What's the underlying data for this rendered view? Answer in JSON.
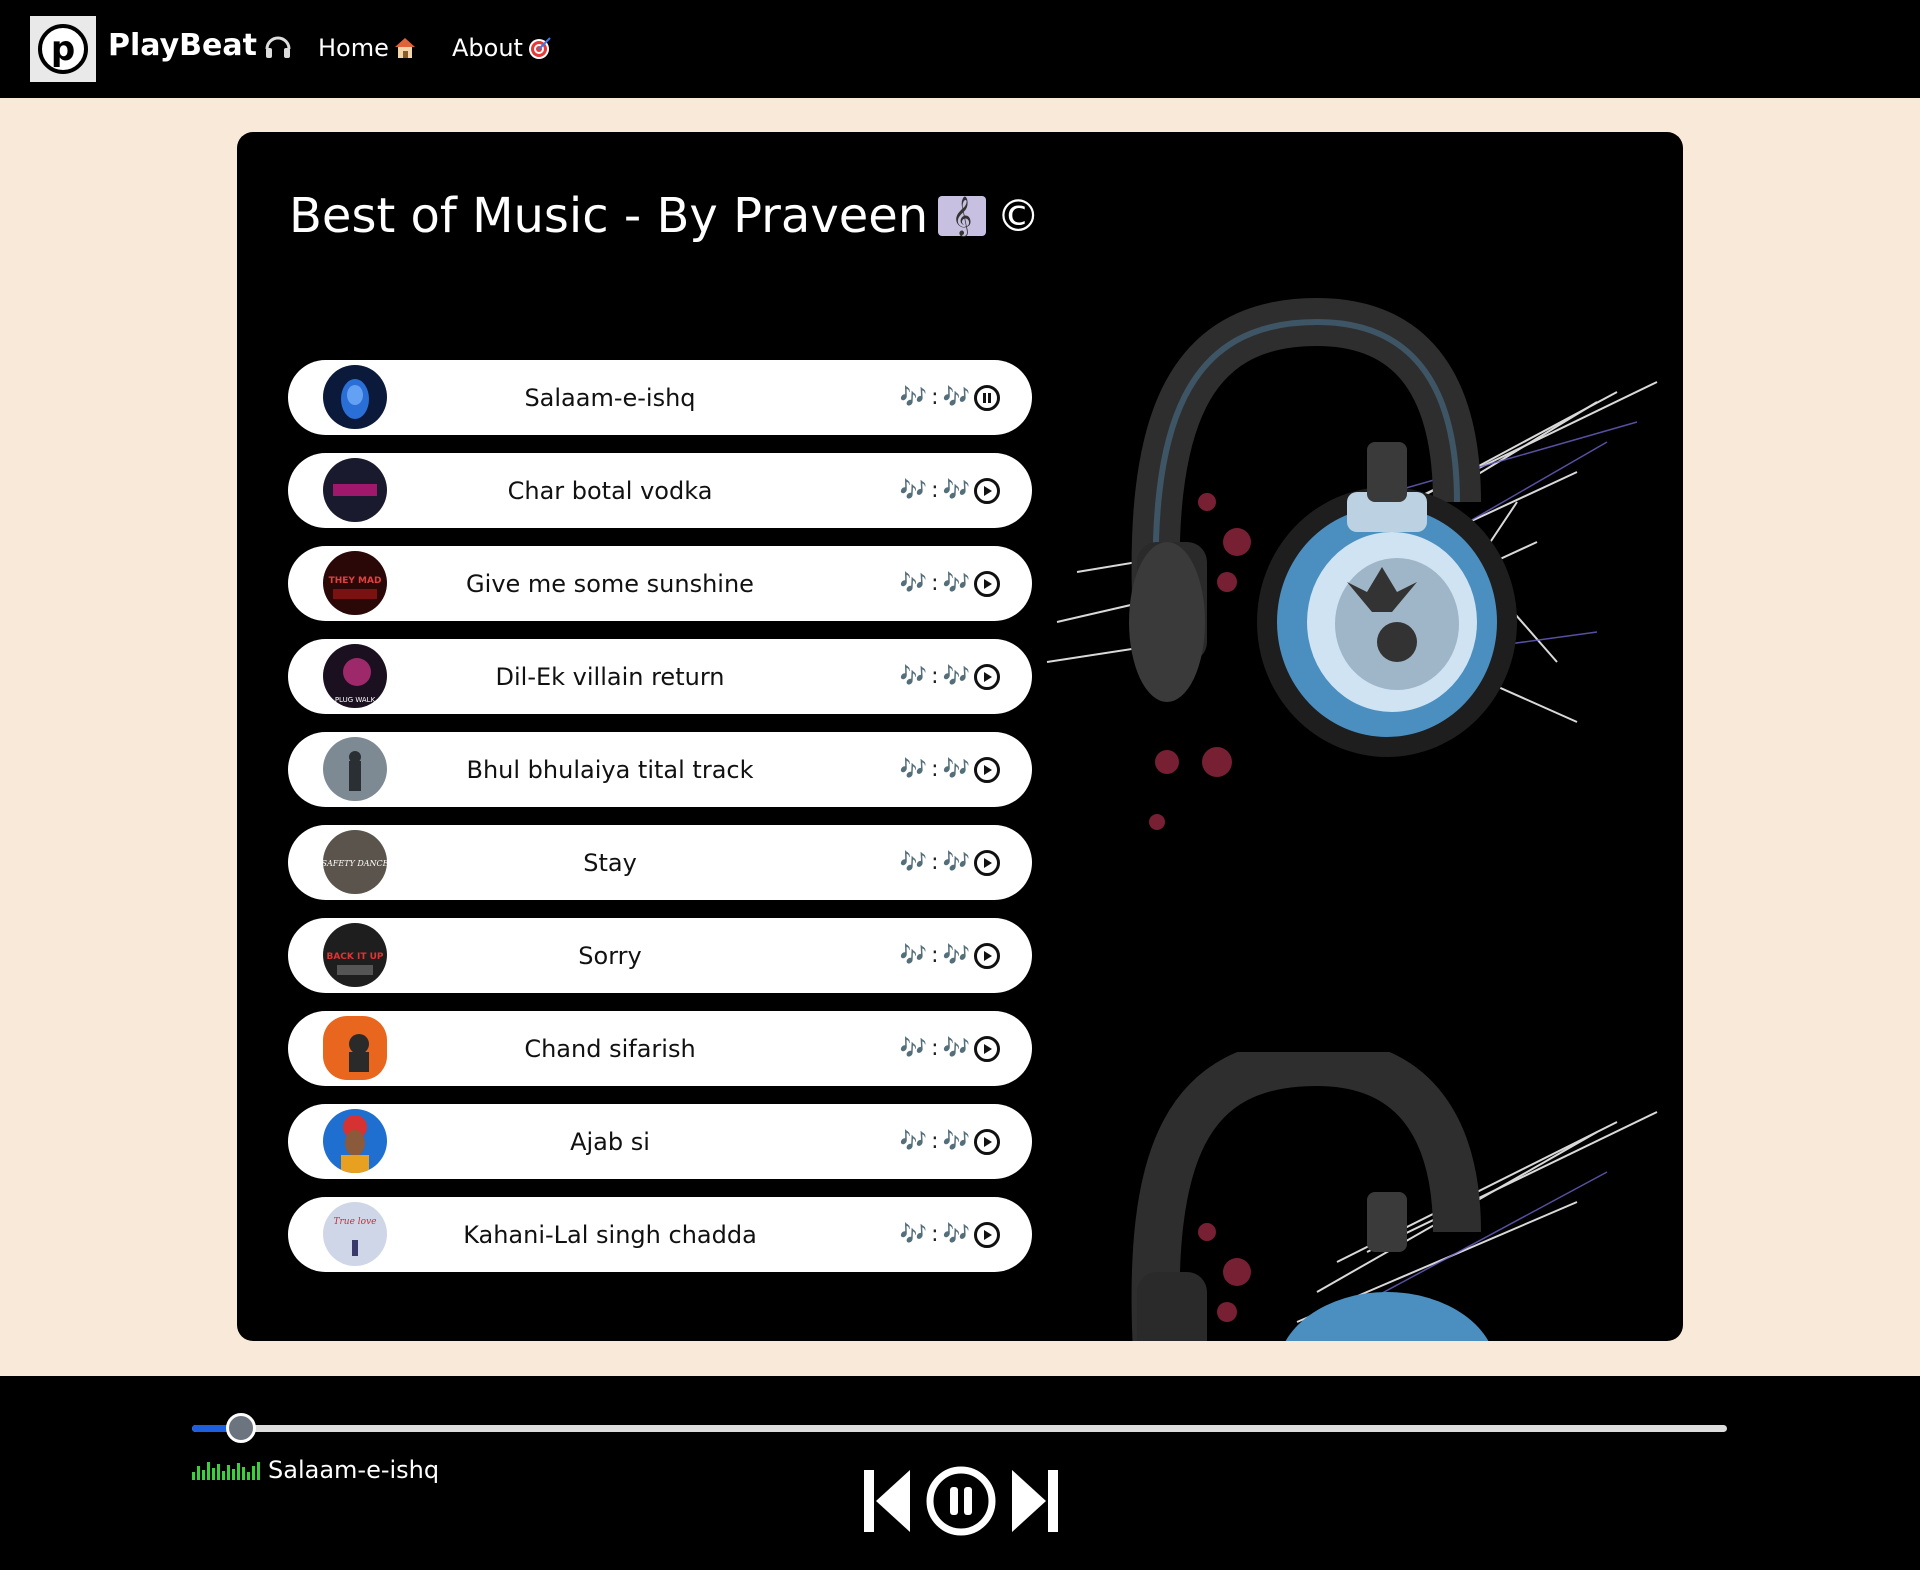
{
  "navbar": {
    "brand": "PlayBeat",
    "brand_icon": "headphones-icon",
    "links": [
      {
        "label": "Home",
        "icon": "house-icon"
      },
      {
        "label": "About",
        "icon": "target-icon"
      }
    ]
  },
  "main": {
    "title": "Best of Music - By Praveen",
    "title_icon": "musical-score-icon",
    "title_symbol": "©",
    "songs": [
      {
        "name": "Salaam-e-ishq",
        "note_left": "🎶",
        "colon": ":",
        "note_right": "🎶",
        "state": "pause"
      },
      {
        "name": "Char botal vodka",
        "note_left": "🎶",
        "colon": ":",
        "note_right": "🎶",
        "state": "play"
      },
      {
        "name": "Give me some sunshine",
        "note_left": "🎶",
        "colon": ":",
        "note_right": "🎶",
        "state": "play"
      },
      {
        "name": "Dil-Ek villain return",
        "note_left": "🎶",
        "colon": ":",
        "note_right": "🎶",
        "state": "play"
      },
      {
        "name": "Bhul bhulaiya tital track",
        "note_left": "🎶",
        "colon": ":",
        "note_right": "🎶",
        "state": "play"
      },
      {
        "name": "Stay",
        "note_left": "🎶",
        "colon": ":",
        "note_right": "🎶",
        "state": "play"
      },
      {
        "name": "Sorry",
        "note_left": "🎶",
        "colon": ":",
        "note_right": "🎶",
        "state": "play"
      },
      {
        "name": "Chand sifarish",
        "note_left": "🎶",
        "colon": ":",
        "note_right": "🎶",
        "state": "play"
      },
      {
        "name": "Ajab si",
        "note_left": "🎶",
        "colon": ":",
        "note_right": "🎶",
        "state": "play"
      },
      {
        "name": "Kahani-Lal singh chadda",
        "note_left": "🎶",
        "colon": ":",
        "note_right": "🎶",
        "state": "play"
      }
    ],
    "cover_art_text": [
      "THEY MAD",
      "PLUG WALK",
      "SAFETY DANCE",
      "BACK IT UP",
      "True love"
    ]
  },
  "player": {
    "now_playing": "Salaam-e-ishq",
    "progress_fraction": 0.032,
    "controls": [
      "previous-icon",
      "pause-icon",
      "next-icon"
    ]
  },
  "colors": {
    "page_bg": "#f9e9d8",
    "nav_bg": "#000000",
    "card_bg": "#000000",
    "progress_fill": "#1e5fe0",
    "note_color": "#6b5fa8",
    "eq_color": "#3bd13b"
  }
}
